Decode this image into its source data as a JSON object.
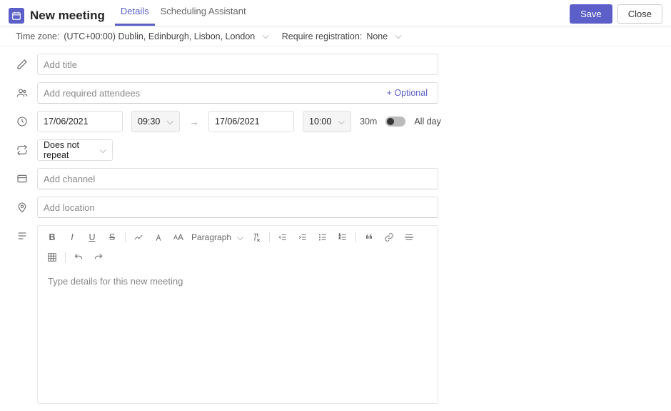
{
  "header": {
    "title": "New meeting",
    "tabs": {
      "details": "Details",
      "scheduling": "Scheduling Assistant"
    },
    "save": "Save",
    "close": "Close"
  },
  "sub": {
    "tz_label": "Time zone:",
    "tz_value": "(UTC+00:00) Dublin, Edinburgh, Lisbon, London",
    "reg_label": "Require registration:",
    "reg_value": "None"
  },
  "form": {
    "title_placeholder": "Add title",
    "attendees_placeholder": "Add required attendees",
    "optional_link": "+ Optional",
    "start_date": "17/06/2021",
    "start_time": "09:30",
    "end_date": "17/06/2021",
    "end_time": "10:00",
    "duration": "30m",
    "all_day": "All day",
    "repeat": "Does not repeat",
    "channel_placeholder": "Add channel",
    "location_placeholder": "Add location"
  },
  "rte": {
    "paragraph": "Paragraph",
    "body_placeholder": "Type details for this new meeting"
  }
}
